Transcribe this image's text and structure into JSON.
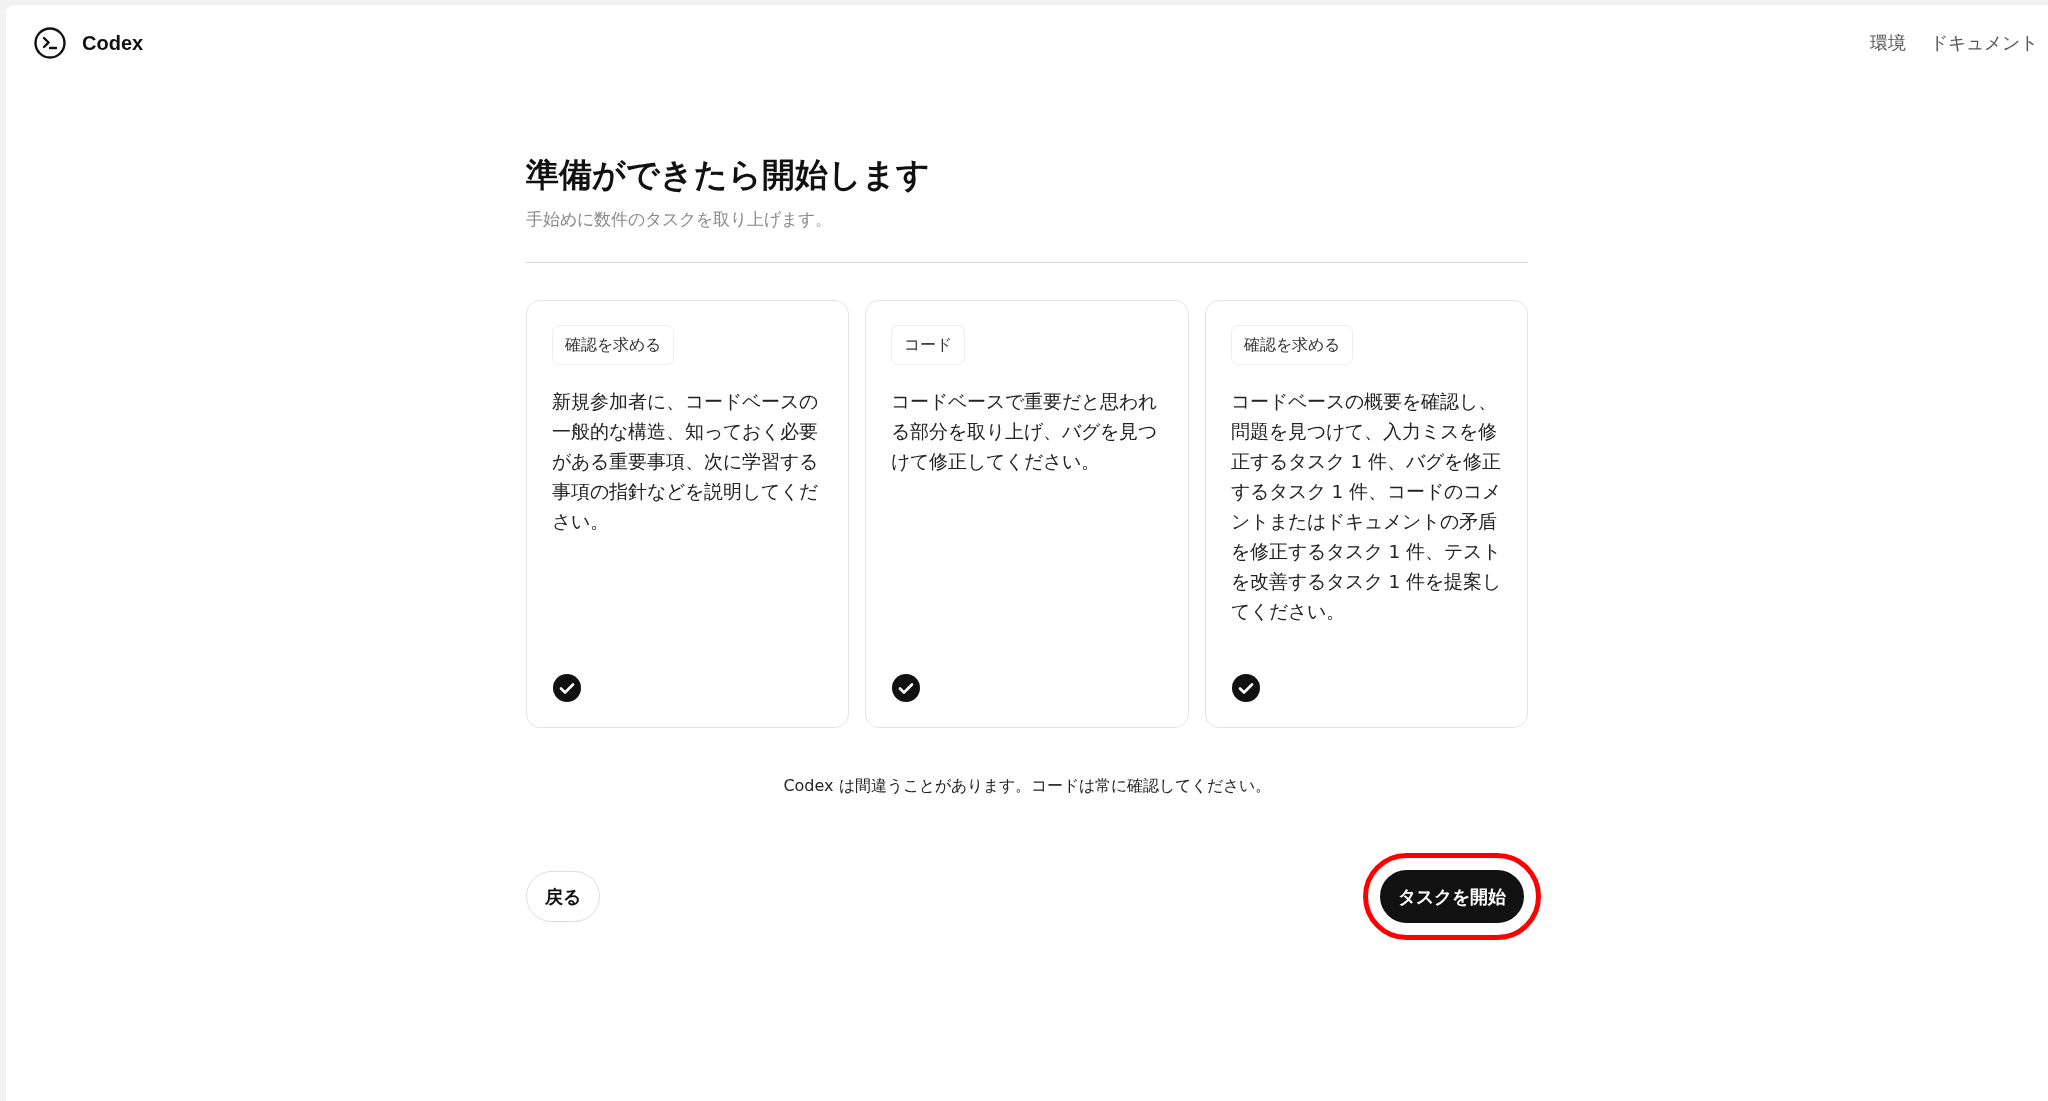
{
  "header": {
    "brand": "Codex",
    "nav": [
      "環境",
      "ドキュメント"
    ]
  },
  "intro": {
    "title": "準備ができたら開始します",
    "subtitle": "手始めに数件のタスクを取り上げます。"
  },
  "tasks": [
    {
      "tag": "確認を求める",
      "text": "新規参加者に、コードベースの一般的な構造、知っておく必要がある重要事項、次に学習する事項の指針などを説明してください。",
      "selected": true
    },
    {
      "tag": "コード",
      "text": "コードベースで重要だと思われる部分を取り上げ、バグを見つけて修正してください。",
      "selected": true
    },
    {
      "tag": "確認を求める",
      "text": "コードベースの概要を確認し、問題を見つけて、入力ミスを修正するタスク 1 件、バグを修正するタスク 1 件、コードのコメントまたはドキュメントの矛盾を修正するタスク 1 件、テストを改善するタスク 1 件を提案してください。",
      "selected": true
    }
  ],
  "disclaimer": "Codex は間違うことがあります。コードは常に確認してください。",
  "actions": {
    "back": "戻る",
    "start": {
      "label": "タスクを開始",
      "highlighted": true
    }
  }
}
